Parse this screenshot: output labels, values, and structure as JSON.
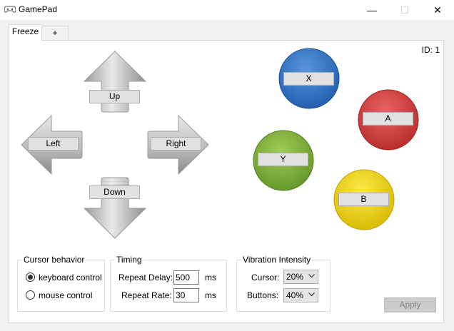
{
  "window": {
    "title": "GamePad",
    "minimize_glyph": "—",
    "maximize_glyph": "☐",
    "close_glyph": "✕",
    "icon": "gamepad-icon"
  },
  "tabs": [
    {
      "label": "Freeze",
      "active": true
    },
    {
      "label": "+",
      "active": false
    }
  ],
  "id_label": "ID: 1",
  "directions": {
    "up": "Up",
    "down": "Down",
    "left": "Left",
    "right": "Right"
  },
  "face_buttons": {
    "x": {
      "label": "X",
      "color": "#2f6fc4"
    },
    "a": {
      "label": "A",
      "color": "#d23a3a"
    },
    "y": {
      "label": "Y",
      "color": "#7fb03a"
    },
    "b": {
      "label": "B",
      "color": "#f0d200"
    }
  },
  "cursor_behavior": {
    "title": "Cursor behavior",
    "options": [
      {
        "label": "keyboard control",
        "selected": true
      },
      {
        "label": "mouse control",
        "selected": false
      }
    ]
  },
  "timing": {
    "title": "Timing",
    "repeat_delay_label": "Repeat Delay:",
    "repeat_delay_value": "500",
    "repeat_delay_unit": "ms",
    "repeat_rate_label": "Repeat Rate:",
    "repeat_rate_value": "30",
    "repeat_rate_unit": "ms"
  },
  "vibration": {
    "title": "Vibration Intensity",
    "cursor_label": "Cursor:",
    "cursor_value": "20%",
    "buttons_label": "Buttons:",
    "buttons_value": "40%"
  },
  "apply_label": "Apply"
}
